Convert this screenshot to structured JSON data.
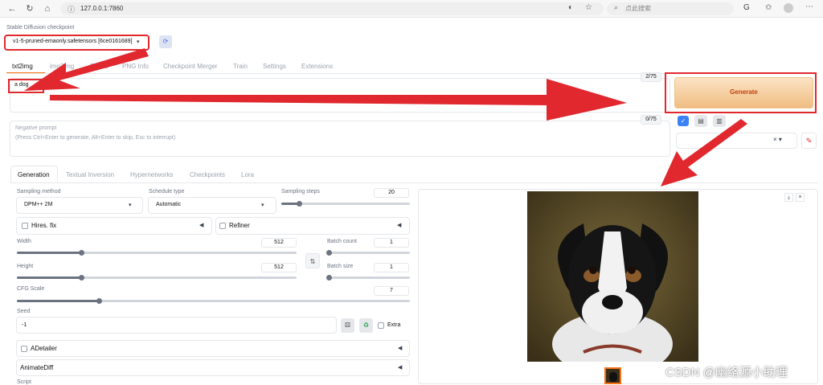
{
  "browser": {
    "url": "127.0.0.1:7860",
    "search_placeholder": "点此搜索"
  },
  "checkpoint": {
    "label": "Stable Diffusion checkpoint",
    "value": "v1-5-pruned-emaonly.safetensors [6ce0161689]"
  },
  "tabs": [
    "txt2img",
    "img2img",
    "Extras",
    "PNG Info",
    "Checkpoint Merger",
    "Train",
    "Settings",
    "Extensions"
  ],
  "prompt": {
    "value": "a dog",
    "count": "2/75"
  },
  "negative": {
    "label": "Negative prompt",
    "placeholder": "(Press Ctrl+Enter to generate, Alt+Enter to skip, Esc to interrupt)",
    "count": "0/75"
  },
  "generate_label": "Generate",
  "subtabs": [
    "Generation",
    "Textual Inversion",
    "Hypernetworks",
    "Checkpoints",
    "Lora"
  ],
  "sampling": {
    "method_label": "Sampling method",
    "method": "DPM++ 2M",
    "schedule_label": "Schedule type",
    "schedule": "Automatic",
    "steps_label": "Sampling steps",
    "steps": "20",
    "steps_fraction": 0.14
  },
  "hires": "Hires. fix",
  "refiner": "Refiner",
  "width": {
    "label": "Width",
    "value": "512",
    "fraction": 0.23
  },
  "height": {
    "label": "Height",
    "value": "512",
    "fraction": 0.23
  },
  "batch_count": {
    "label": "Batch count",
    "value": "1",
    "fraction": 0.02
  },
  "batch_size": {
    "label": "Batch size",
    "value": "1",
    "fraction": 0.02
  },
  "cfg": {
    "label": "CFG Scale",
    "value": "7",
    "fraction": 0.21
  },
  "seed": {
    "label": "Seed",
    "value": "-1",
    "extra": "Extra"
  },
  "adetailer": "ADetailer",
  "animatediff": "AnimateDiff",
  "script": "Script",
  "watermark": "CSDN @幽络源小助理",
  "colors": {
    "accent": "#f2c48a",
    "annotation": "#e0282e"
  }
}
